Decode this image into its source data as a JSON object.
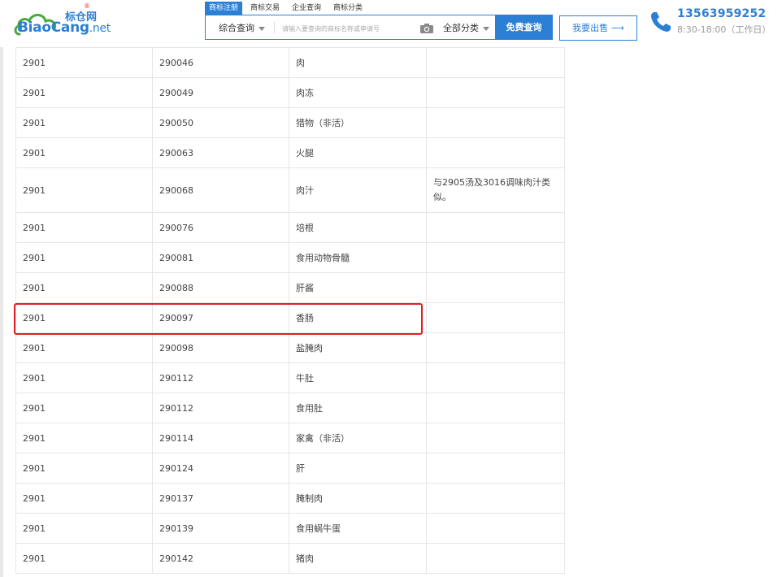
{
  "brand": {
    "name_cn": "标仓网",
    "registered_mark": "®",
    "name_en_main": "BiaoCang",
    "name_en_suffix": ".net"
  },
  "nav_tabs": [
    {
      "label": "商标注册",
      "active": true
    },
    {
      "label": "商标交易",
      "active": false
    },
    {
      "label": "企业查询",
      "active": false
    },
    {
      "label": "商标分类",
      "active": false
    }
  ],
  "search": {
    "type_select": "综合查询",
    "placeholder": "请输入要查询的商标名称或申请号",
    "category_select": "全部分类",
    "button_label": "免费查询"
  },
  "sell_button": {
    "label": "我要出售",
    "arrow": "⟶"
  },
  "contact": {
    "phone": "13563959252",
    "hours": "8:30-18:00（工作日）"
  },
  "colors": {
    "accent": "#2b7fd4",
    "highlight": "#e02020"
  },
  "table": {
    "rows": [
      {
        "class_code": "2901",
        "item_code": "290046",
        "name": "肉",
        "note": ""
      },
      {
        "class_code": "2901",
        "item_code": "290049",
        "name": "肉冻",
        "note": ""
      },
      {
        "class_code": "2901",
        "item_code": "290050",
        "name": "猎物（非活）",
        "note": ""
      },
      {
        "class_code": "2901",
        "item_code": "290063",
        "name": "火腿",
        "note": ""
      },
      {
        "class_code": "2901",
        "item_code": "290068",
        "name": "肉汁",
        "note": "与2905汤及3016调味肉汁类似。"
      },
      {
        "class_code": "2901",
        "item_code": "290076",
        "name": "培根",
        "note": ""
      },
      {
        "class_code": "2901",
        "item_code": "290081",
        "name": "食用动物骨髓",
        "note": ""
      },
      {
        "class_code": "2901",
        "item_code": "290088",
        "name": "肝酱",
        "note": ""
      },
      {
        "class_code": "2901",
        "item_code": "290097",
        "name": "香肠",
        "note": ""
      },
      {
        "class_code": "2901",
        "item_code": "290098",
        "name": "盐腌肉",
        "note": ""
      },
      {
        "class_code": "2901",
        "item_code": "290112",
        "name": "牛肚",
        "note": ""
      },
      {
        "class_code": "2901",
        "item_code": "290112",
        "name": "食用肚",
        "note": ""
      },
      {
        "class_code": "2901",
        "item_code": "290114",
        "name": "家禽（非活）",
        "note": ""
      },
      {
        "class_code": "2901",
        "item_code": "290124",
        "name": "肝",
        "note": ""
      },
      {
        "class_code": "2901",
        "item_code": "290137",
        "name": "腌制肉",
        "note": ""
      },
      {
        "class_code": "2901",
        "item_code": "290139",
        "name": "食用蜗牛蛋",
        "note": ""
      },
      {
        "class_code": "2901",
        "item_code": "290142",
        "name": "猪肉",
        "note": ""
      }
    ]
  }
}
